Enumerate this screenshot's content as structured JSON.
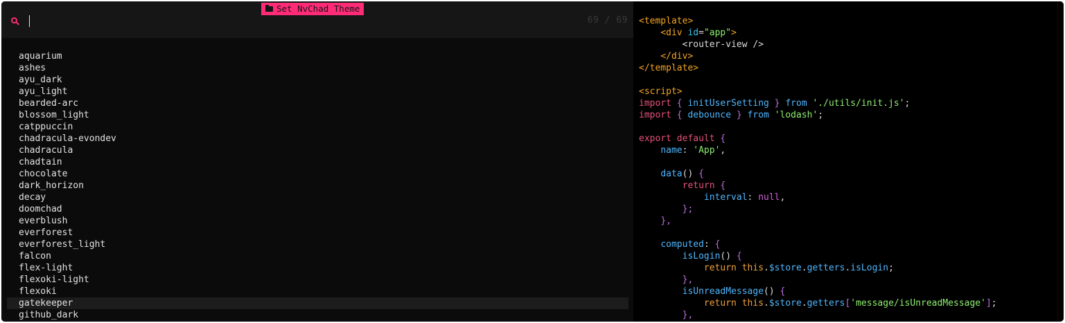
{
  "picker": {
    "title": "Set NvChad Theme",
    "title_icon": "folder-icon",
    "prompt_value": "",
    "counter": "69 / 69",
    "accent_color": "#ff2b77",
    "selected_index": 21,
    "items": [
      "aquarium",
      "ashes",
      "ayu_dark",
      "ayu_light",
      "bearded-arc",
      "blossom_light",
      "catppuccin",
      "chadracula-evondev",
      "chadracula",
      "chadtain",
      "chocolate",
      "dark_horizon",
      "decay",
      "doomchad",
      "everblush",
      "everforest",
      "everforest_light",
      "falcon",
      "flex-light",
      "flexoki-light",
      "flexoki",
      "gatekeeper",
      "github_dark"
    ]
  },
  "editor": {
    "lines": [
      [
        [
          "<template>",
          "tag"
        ]
      ],
      [
        [
          "    ",
          "plain"
        ],
        [
          "<div ",
          "tag"
        ],
        [
          "id",
          "attr"
        ],
        [
          "=",
          "plain"
        ],
        [
          "\"app\"",
          "str"
        ],
        [
          ">",
          "tag"
        ]
      ],
      [
        [
          "        ",
          "plain"
        ],
        [
          "<router-view />",
          "default"
        ]
      ],
      [
        [
          "    ",
          "plain"
        ],
        [
          "</div>",
          "tag"
        ]
      ],
      [
        [
          "</template>",
          "tag"
        ]
      ],
      [
        [
          "",
          "plain"
        ]
      ],
      [
        [
          "<script>",
          "tag"
        ]
      ],
      [
        [
          "import",
          "kw2"
        ],
        [
          " { ",
          "punct"
        ],
        [
          "initUserSetting",
          "prop"
        ],
        [
          " } ",
          "punct"
        ],
        [
          "from",
          "prop"
        ],
        [
          " ",
          "plain"
        ],
        [
          "'./utils/init.js'",
          "str"
        ],
        [
          ";",
          "plain"
        ]
      ],
      [
        [
          "import",
          "kw2"
        ],
        [
          " { ",
          "punct"
        ],
        [
          "debounce",
          "prop"
        ],
        [
          " } ",
          "punct"
        ],
        [
          "from",
          "prop"
        ],
        [
          " ",
          "plain"
        ],
        [
          "'lodash'",
          "str"
        ],
        [
          ";",
          "plain"
        ]
      ],
      [
        [
          "",
          "plain"
        ]
      ],
      [
        [
          "export default",
          "kw2"
        ],
        [
          " {",
          "punct"
        ]
      ],
      [
        [
          "    ",
          "plain"
        ],
        [
          "name",
          "prop"
        ],
        [
          ": ",
          "plain"
        ],
        [
          "'App'",
          "str"
        ],
        [
          ",",
          "plain"
        ]
      ],
      [
        [
          "",
          "plain"
        ]
      ],
      [
        [
          "    ",
          "plain"
        ],
        [
          "data",
          "prop"
        ],
        [
          "() ",
          "plain"
        ],
        [
          "{",
          "punct"
        ]
      ],
      [
        [
          "        ",
          "plain"
        ],
        [
          "return",
          "kw2"
        ],
        [
          " {",
          "punct"
        ]
      ],
      [
        [
          "            ",
          "plain"
        ],
        [
          "interval",
          "prop"
        ],
        [
          ": ",
          "plain"
        ],
        [
          "null",
          "null"
        ],
        [
          ",",
          "plain"
        ]
      ],
      [
        [
          "        ",
          "plain"
        ],
        [
          "};",
          "punct"
        ]
      ],
      [
        [
          "    ",
          "plain"
        ],
        [
          "},",
          "punct"
        ]
      ],
      [
        [
          "",
          "plain"
        ]
      ],
      [
        [
          "    ",
          "plain"
        ],
        [
          "computed",
          "prop"
        ],
        [
          ": ",
          "plain"
        ],
        [
          "{",
          "punct"
        ]
      ],
      [
        [
          "        ",
          "plain"
        ],
        [
          "isLogin",
          "prop"
        ],
        [
          "() ",
          "plain"
        ],
        [
          "{",
          "punct"
        ]
      ],
      [
        [
          "            ",
          "plain"
        ],
        [
          "return",
          "this"
        ],
        [
          " ",
          "plain"
        ],
        [
          "this",
          "this"
        ],
        [
          ".",
          "plain"
        ],
        [
          "$store",
          "prop"
        ],
        [
          ".",
          "plain"
        ],
        [
          "getters",
          "prop"
        ],
        [
          ".",
          "plain"
        ],
        [
          "isLogin",
          "prop"
        ],
        [
          ";",
          "plain"
        ]
      ],
      [
        [
          "        ",
          "plain"
        ],
        [
          "},",
          "punct"
        ]
      ],
      [
        [
          "        ",
          "plain"
        ],
        [
          "isUnreadMessage",
          "prop"
        ],
        [
          "() ",
          "plain"
        ],
        [
          "{",
          "punct"
        ]
      ],
      [
        [
          "            ",
          "plain"
        ],
        [
          "return",
          "this"
        ],
        [
          " ",
          "plain"
        ],
        [
          "this",
          "this"
        ],
        [
          ".",
          "plain"
        ],
        [
          "$store",
          "prop"
        ],
        [
          ".",
          "plain"
        ],
        [
          "getters",
          "prop"
        ],
        [
          "[",
          "punct"
        ],
        [
          "'message/isUnreadMessage'",
          "str"
        ],
        [
          "]",
          "punct"
        ],
        [
          ";",
          "plain"
        ]
      ],
      [
        [
          "        ",
          "plain"
        ],
        [
          "},",
          "punct"
        ]
      ]
    ]
  }
}
